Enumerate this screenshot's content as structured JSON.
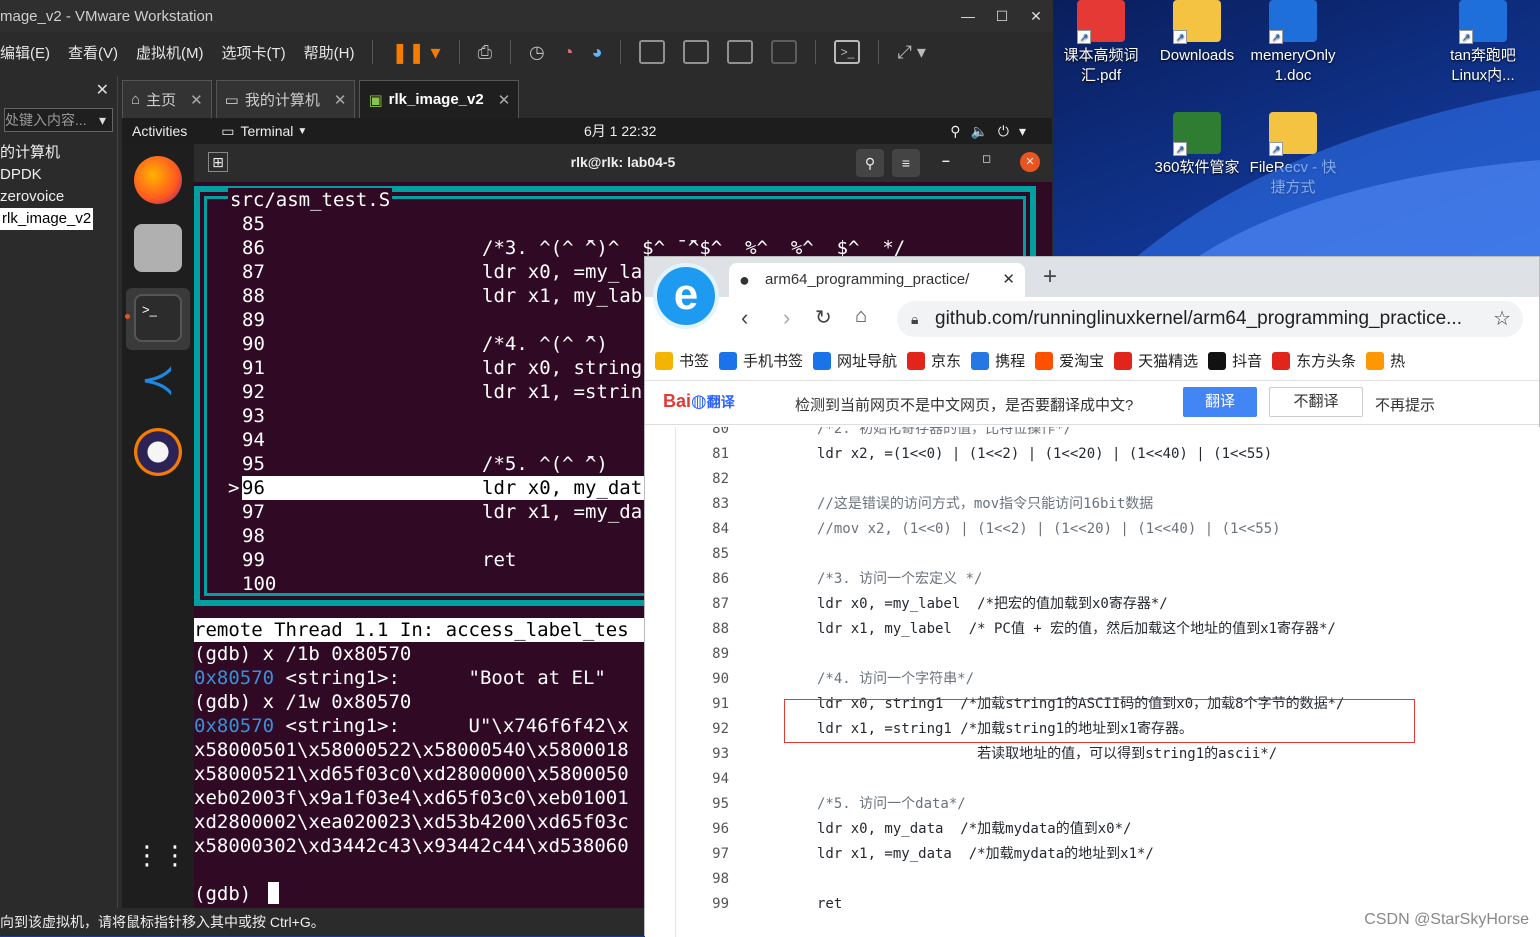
{
  "vmware": {
    "title": "mage_v2 - VMware Workstation",
    "menu": [
      "编辑(E)",
      "查看(V)",
      "虚拟机(M)",
      "选项卡(T)",
      "帮助(H)"
    ],
    "library_search_placeholder": "处键入内容...",
    "library_items": [
      "的计算机",
      "DPDK",
      "zerovoice",
      "rlk_image_v2"
    ],
    "tabs": [
      "主页",
      "我的计算机",
      "rlk_image_v2"
    ],
    "status_text": "向到该虚拟机，请将鼠标指针移入其中或按 Ctrl+G。"
  },
  "ubuntu": {
    "activities": "Activities",
    "app_menu": "Terminal",
    "clock": "6月 1  22:32",
    "terminal_title": "rlk@rlk: lab04-5"
  },
  "terminal": {
    "src_title": "src/asm_test.S",
    "src_lines": [
      {
        "marker": "",
        "num": "85",
        "code": ""
      },
      {
        "marker": "",
        "num": "86",
        "code": "/*3. ^(^ ̄^)^  $^ ̄ ̄^$^  %^  %^  $^  */"
      },
      {
        "marker": "",
        "num": "87",
        "code": "ldr x0, =my_la"
      },
      {
        "marker": "",
        "num": "88",
        "code": "ldr x1, my_lab"
      },
      {
        "marker": "",
        "num": "89",
        "code": ""
      },
      {
        "marker": "",
        "num": "90",
        "code": "/*4. ^(^ ̄^)"
      },
      {
        "marker": "",
        "num": "91",
        "code": "ldr x0, string"
      },
      {
        "marker": "",
        "num": "92",
        "code": "ldr x1, =strin"
      },
      {
        "marker": "",
        "num": "93",
        "code": ""
      },
      {
        "marker": "",
        "num": "94",
        "code": ""
      },
      {
        "marker": "",
        "num": "95",
        "code": "/*5. ^(^ ̄^)"
      },
      {
        "marker": ">",
        "num": "96",
        "code": "ldr x0, my_dat"
      },
      {
        "marker": "",
        "num": "97",
        "code": "ldr x1, =my_da"
      },
      {
        "marker": "",
        "num": "98",
        "code": ""
      },
      {
        "marker": "",
        "num": "99",
        "code": "ret"
      },
      {
        "marker": "",
        "num": "100",
        "code": ""
      }
    ],
    "status_bar": "remote Thread 1.1 In: access_label_tes",
    "gdb_lines": [
      "(gdb) x /1b 0x80570",
      "0x80570 <string1>:      \"Boot at EL\"",
      "(gdb) x /1w 0x80570",
      "0x80570 <string1>:      U\"\\x746f6f42\\x",
      "x58000501\\x58000522\\x58000540\\x5800018",
      "x58000521\\xd65f03c0\\xd2800000\\x5800050",
      "xeb02003f\\x9a1f03e4\\xd65f03c0\\xeb01001",
      "xd2800002\\xea020023\\xd53b4200\\xd65f03c",
      "x58000302\\xd3442c43\\x93442c44\\xd538060",
      "",
      "(gdb) "
    ]
  },
  "desktop_icons": [
    {
      "label": "课本高频词汇.pdf",
      "icon": "pdf-icon",
      "color": "#e53935"
    },
    {
      "label": "Downloads",
      "icon": "folder-icon",
      "color": "#f5c342"
    },
    {
      "label": "memeryOnly 1.doc",
      "icon": "word-icon",
      "color": "#1e6fd9"
    },
    {
      "label": "tan奔跑吧Linux内...",
      "icon": "word-icon",
      "color": "#1e6fd9"
    },
    {
      "label": "360软件管家",
      "icon": "360-icon",
      "color": "#2e7d32"
    },
    {
      "label": "FileRecv - 快捷方式",
      "icon": "folder-icon",
      "color": "#f5c342"
    }
  ],
  "browser": {
    "tab_title": "arm64_programming_practice/",
    "url": "github.com/runninglinuxkernel/arm64_programming_practice...",
    "bookmarks": [
      {
        "label": "书签",
        "color": "#f4b400"
      },
      {
        "label": "手机书签",
        "color": "#1a73e8"
      },
      {
        "label": "网址导航",
        "color": "#1a73e8"
      },
      {
        "label": "京东",
        "color": "#e1251b"
      },
      {
        "label": "携程",
        "color": "#2577e3"
      },
      {
        "label": "爱淘宝",
        "color": "#ff5000"
      },
      {
        "label": "天猫精选",
        "color": "#e1251b"
      },
      {
        "label": "抖音",
        "color": "#111111"
      },
      {
        "label": "东方头条",
        "color": "#e1251b"
      },
      {
        "label": "热",
        "color": "#ff9800"
      }
    ],
    "translate_bar": {
      "brand": "Bai",
      "brand_suffix": "翻译",
      "message": "检测到当前网页不是中文网页，是否要翻译成中文?",
      "translate_button": "翻译",
      "no_translate_button": "不翻译",
      "never_label": "不再提示"
    },
    "code_lines": [
      {
        "num": "80",
        "code": "/*2. 初始化寄存器的值，比特位操作*/",
        "type": "cm"
      },
      {
        "num": "81",
        "code": "ldr x2, =(1<<0) | (1<<2) | (1<<20) | (1<<40) | (1<<55)",
        "type": "kw"
      },
      {
        "num": "82",
        "code": "",
        "type": "kw"
      },
      {
        "num": "83",
        "code": "//这是错误的访问方式，mov指令只能访问16bit数据",
        "type": "cm"
      },
      {
        "num": "84",
        "code": "//mov x2, (1<<0) | (1<<2) | (1<<20) | (1<<40) | (1<<55)",
        "type": "cm"
      },
      {
        "num": "85",
        "code": "",
        "type": "kw"
      },
      {
        "num": "86",
        "code": "/*3. 访问一个宏定义 */",
        "type": "cm"
      },
      {
        "num": "87",
        "code": "ldr x0, =my_label  /*把宏的值加载到x0寄存器*/",
        "type": "kw"
      },
      {
        "num": "88",
        "code": "ldr x1, my_label  /* PC值 + 宏的值，然后加载这个地址的值到x1寄存器*/",
        "type": "kw"
      },
      {
        "num": "89",
        "code": "",
        "type": "kw"
      },
      {
        "num": "90",
        "code": "/*4. 访问一个字符串*/",
        "type": "cm"
      },
      {
        "num": "91",
        "code": "ldr x0, string1  /*加载string1的ASCII码的值到x0，加载8个字节的数据*/",
        "type": "kw"
      },
      {
        "num": "92",
        "code": "ldr x1, =string1 /*加载string1的地址到x1寄存器。",
        "type": "kw"
      },
      {
        "num": "93",
        "code": "                   若读取地址的值，可以得到string1的ascii*/",
        "type": "kw"
      },
      {
        "num": "94",
        "code": "",
        "type": "kw"
      },
      {
        "num": "95",
        "code": "/*5. 访问一个data*/",
        "type": "cm"
      },
      {
        "num": "96",
        "code": "ldr x0, my_data  /*加载mydata的值到x0*/",
        "type": "kw"
      },
      {
        "num": "97",
        "code": "ldr x1, =my_data  /*加载mydata的地址到x1*/",
        "type": "kw"
      },
      {
        "num": "98",
        "code": "",
        "type": "kw"
      },
      {
        "num": "99",
        "code": "ret",
        "type": "kw"
      }
    ],
    "watermark": "CSDN @StarSkyHorse"
  }
}
